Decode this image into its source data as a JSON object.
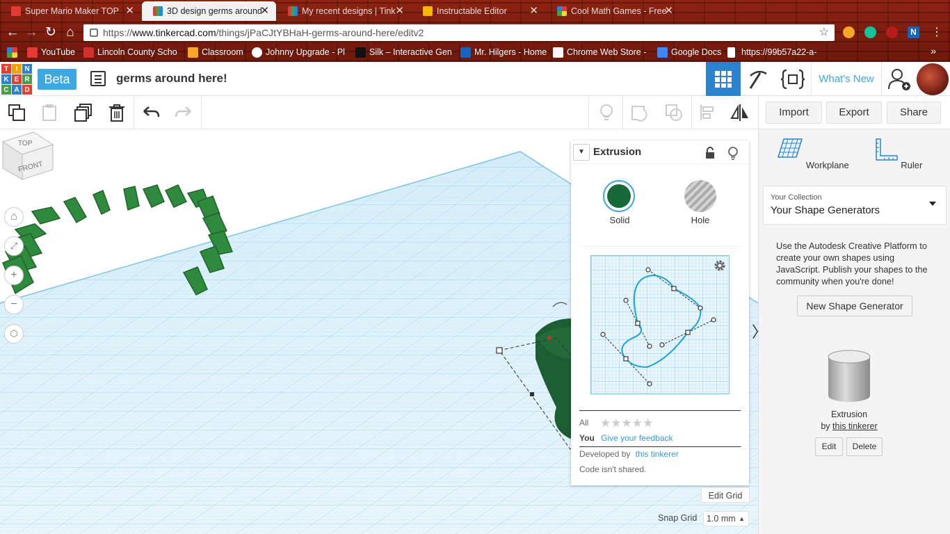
{
  "browser": {
    "tabs": [
      {
        "title": "Super Mario Maker TOP",
        "fav_color": "#e53935"
      },
      {
        "title": "3D design germs around",
        "fav_color": "#e53935"
      },
      {
        "title": "My recent designs | Tink",
        "fav_color": "#e53935"
      },
      {
        "title": "Instructable Editor",
        "fav_color": "#f5b700"
      },
      {
        "title": "Cool Math Games - Free",
        "fav_color": "#1e88e5"
      }
    ],
    "url_scheme": "https://",
    "url_host": "www.tinkercad.com",
    "url_path": "/things/jPaCJtYBHaH-germs-around-here/editv2",
    "bookmarks": [
      {
        "label": "YouTube",
        "fav_color": "#e53935"
      },
      {
        "label": "Lincoln County Scho",
        "fav_color": "#d32f2f"
      },
      {
        "label": "Classroom",
        "fav_color": "#f9a825"
      },
      {
        "label": "Johnny Upgrade - Pl",
        "fav_color": "#ffffff"
      },
      {
        "label": "Silk – Interactive Gen",
        "fav_color": "#111111"
      },
      {
        "label": "Mr. Hilgers - Home",
        "fav_color": "#1565c0"
      },
      {
        "label": "Chrome Web Store -",
        "fav_color": "#f5f5f5"
      },
      {
        "label": "Google Docs",
        "fav_color": "#4285f4"
      },
      {
        "label": "https://99b57a22-a-",
        "fav_color": "#ffffff"
      }
    ]
  },
  "header": {
    "logo_letters": [
      "T",
      "I",
      "N",
      "K",
      "E",
      "R",
      "C",
      "A",
      "D"
    ],
    "beta_label": "Beta",
    "design_title": "germs around here!",
    "whats_new": "What's New"
  },
  "toolbar": {
    "import_label": "Import",
    "export_label": "Export",
    "share_label": "Share"
  },
  "viewcube": {
    "top": "TOP",
    "front": "FRONT"
  },
  "inspector": {
    "title": "Extrusion",
    "solid_label": "Solid",
    "hole_label": "Hole",
    "solid_color": "#17693a",
    "rating_all": "All",
    "rating_you": "You",
    "feedback_link": "Give your feedback",
    "developed_by": "Developed by",
    "developer": "this tinkerer",
    "code_note": "Code isn't shared."
  },
  "grid": {
    "edit_grid": "Edit Grid",
    "snap_grid_label": "Snap Grid",
    "snap_value": "1.0 mm"
  },
  "right_panel": {
    "workplane_label": "Workplane",
    "ruler_label": "Ruler",
    "collection_small": "Your Collection",
    "collection_name": "Your Shape Generators",
    "description": "Use the Autodesk Creative Platform to create your own shapes using JavaScript. Publish your shapes to the community when you're done!",
    "new_generator": "New Shape Generator",
    "shape_name": "Extrusion",
    "by_label": "by",
    "shape_author": "this tinkerer",
    "edit_label": "Edit",
    "delete_label": "Delete"
  },
  "colors": {
    "accent": "#2d82cf",
    "shape_green": "#2e8b3e",
    "grid_blue": "#8ccbe8"
  }
}
